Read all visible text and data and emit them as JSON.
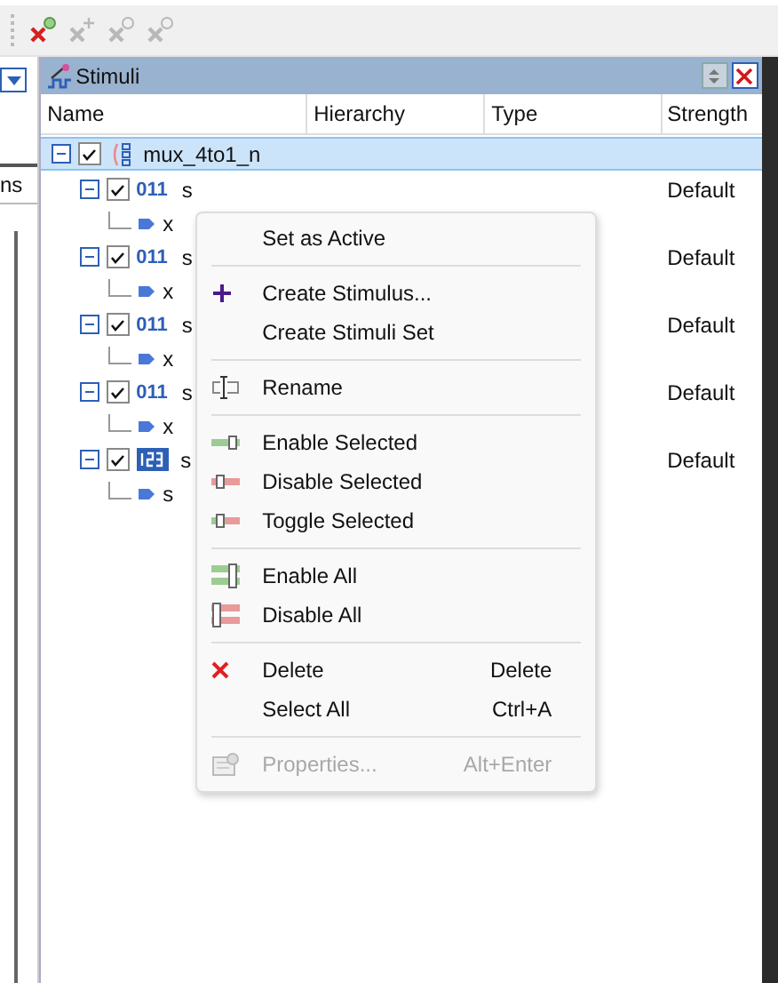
{
  "left_panel": {
    "tab_label": "ns"
  },
  "panel": {
    "title": "Stimuli"
  },
  "columns": [
    "Name",
    "Hierarchy",
    "Type",
    "Strength"
  ],
  "tree": [
    {
      "name": "mux_4to1_n",
      "checked": true,
      "selected": true,
      "expanded": true,
      "children": [
        {
          "kind": "bits",
          "badge": "011",
          "name": "s",
          "strength": "Default",
          "checked": true,
          "expanded": true,
          "children": [
            {
              "name": "x"
            }
          ]
        },
        {
          "kind": "bits",
          "badge": "011",
          "name": "s",
          "strength": "Default",
          "checked": true,
          "expanded": true,
          "children": [
            {
              "name": "x"
            }
          ]
        },
        {
          "kind": "bits",
          "badge": "011",
          "name": "s",
          "strength": "Default",
          "checked": true,
          "expanded": true,
          "children": [
            {
              "name": "x"
            }
          ]
        },
        {
          "kind": "bits",
          "badge": "011",
          "name": "s",
          "strength": "Default",
          "checked": true,
          "expanded": true,
          "children": [
            {
              "name": "x"
            }
          ]
        },
        {
          "kind": "counter",
          "name": "s",
          "strength": "Default",
          "checked": true,
          "expanded": true,
          "children": [
            {
              "name": "s"
            }
          ]
        }
      ]
    }
  ],
  "context_menu": [
    {
      "kind": "plain",
      "label": "Set as Active",
      "disabled": false
    },
    {
      "kind": "separator"
    },
    {
      "kind": "create",
      "label": "Create Stimulus...",
      "disabled": false
    },
    {
      "kind": "plain",
      "label": "Create Stimuli Set",
      "disabled": false
    },
    {
      "kind": "separator"
    },
    {
      "kind": "rename",
      "label": "Rename",
      "disabled": false
    },
    {
      "kind": "separator"
    },
    {
      "kind": "enable",
      "label": "Enable Selected",
      "disabled": false
    },
    {
      "kind": "disable",
      "label": "Disable Selected",
      "disabled": false
    },
    {
      "kind": "toggle",
      "label": "Toggle Selected",
      "disabled": false
    },
    {
      "kind": "separator"
    },
    {
      "kind": "enableall",
      "label": "Enable All",
      "disabled": false
    },
    {
      "kind": "disableall",
      "label": "Disable All",
      "disabled": false
    },
    {
      "kind": "separator"
    },
    {
      "kind": "delete",
      "label": "Delete",
      "shortcut": "Delete",
      "disabled": false
    },
    {
      "kind": "plain",
      "label": "Select All",
      "shortcut": "Ctrl+A",
      "disabled": false
    },
    {
      "kind": "separator"
    },
    {
      "kind": "properties",
      "label": "Properties...",
      "shortcut": "Alt+Enter",
      "disabled": true
    }
  ]
}
